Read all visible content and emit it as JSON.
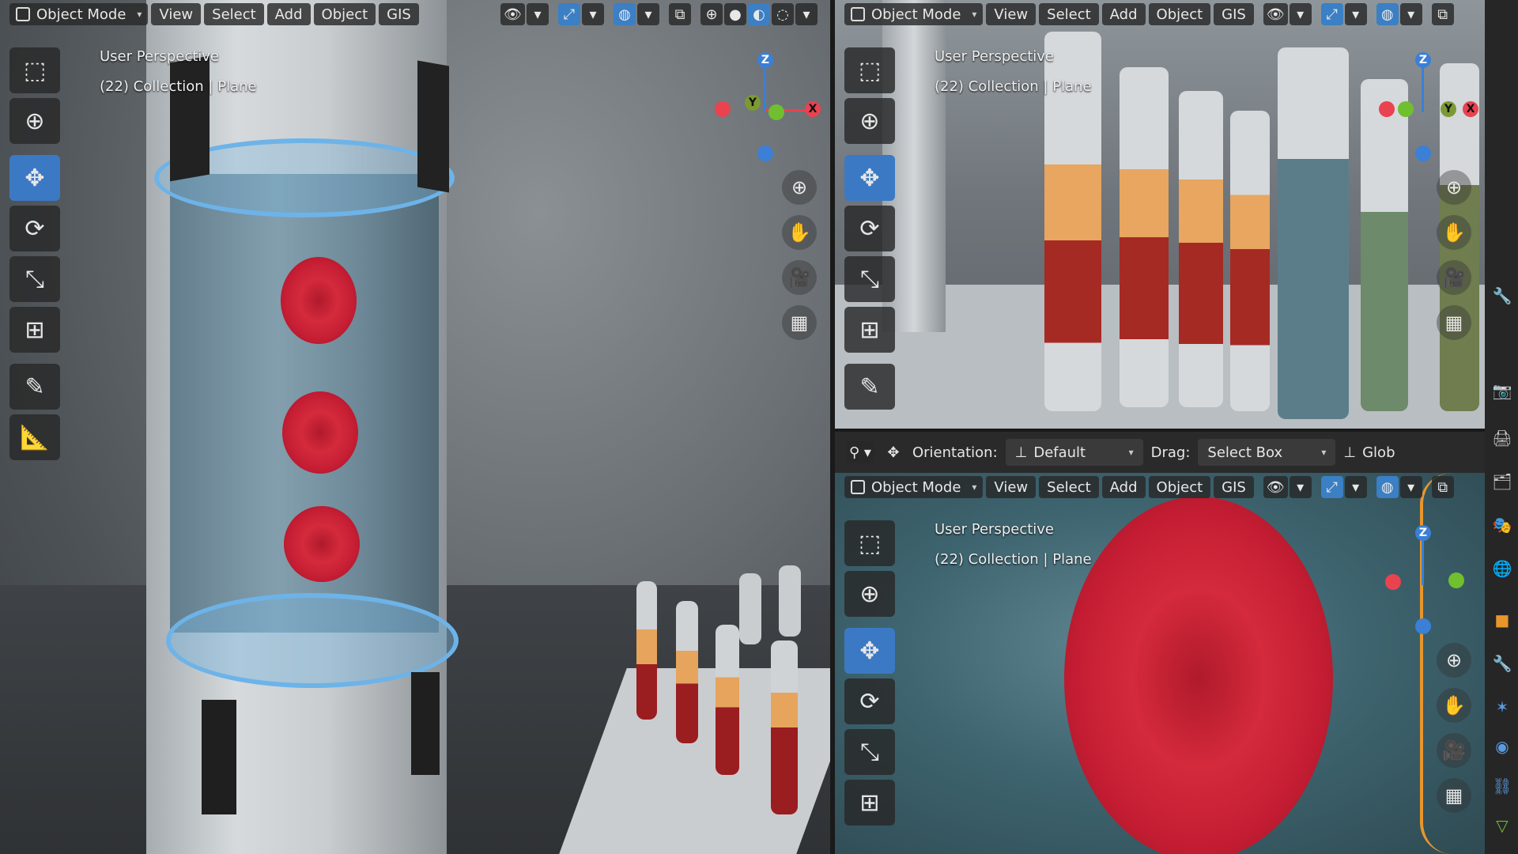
{
  "header": {
    "mode_label": "Object Mode",
    "menus": [
      "View",
      "Select",
      "Add",
      "Object",
      "GIS"
    ]
  },
  "viewports": {
    "left": {
      "perspective": "User Perspective",
      "collection": "(22) Collection | Plane"
    },
    "top_right": {
      "perspective": "User Perspective",
      "collection": "(22) Collection | Plane"
    },
    "bottom_right": {
      "perspective": "User Perspective",
      "collection": "(22) Collection | Plane"
    }
  },
  "gizmo": {
    "x": "X",
    "y": "Y",
    "z": "Z"
  },
  "tool_settings": {
    "orientation_label": "Orientation:",
    "orientation_value": "Default",
    "drag_label": "Drag:",
    "drag_value": "Select Box",
    "global_label": "Glob"
  },
  "colors": {
    "accent": "#3c79c4",
    "axis_x": "#e8434f",
    "axis_y": "#6fbf2f",
    "axis_z": "#3b7fd6"
  },
  "tools": [
    "select-box-icon",
    "cursor-icon",
    "move-icon",
    "rotate-icon",
    "scale-icon",
    "transform-icon",
    "annotate-icon",
    "measure-icon"
  ],
  "nav_icons": [
    "zoom-icon",
    "pan-hand-icon",
    "camera-icon",
    "grid-icon"
  ]
}
